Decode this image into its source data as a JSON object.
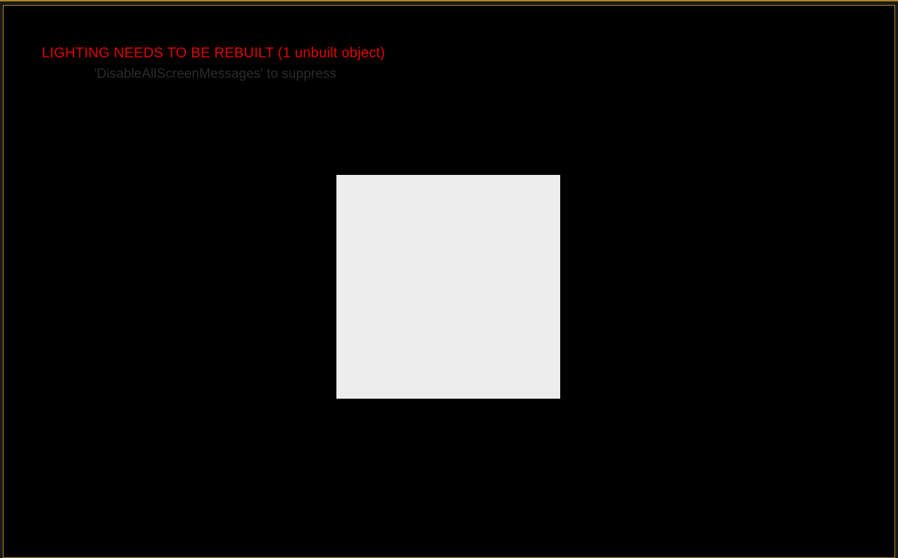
{
  "viewport": {
    "warning_message": "LIGHTING NEEDS TO BE REBUILT (1 unbuilt object)",
    "suppress_hint": "'DisableAllScreenMessages' to suppress"
  },
  "colors": {
    "accent_border": "#b08820",
    "warning_red": "#e40000",
    "hint_dim": "#2a2a2a",
    "plane": "#ededed",
    "background": "#000000"
  }
}
